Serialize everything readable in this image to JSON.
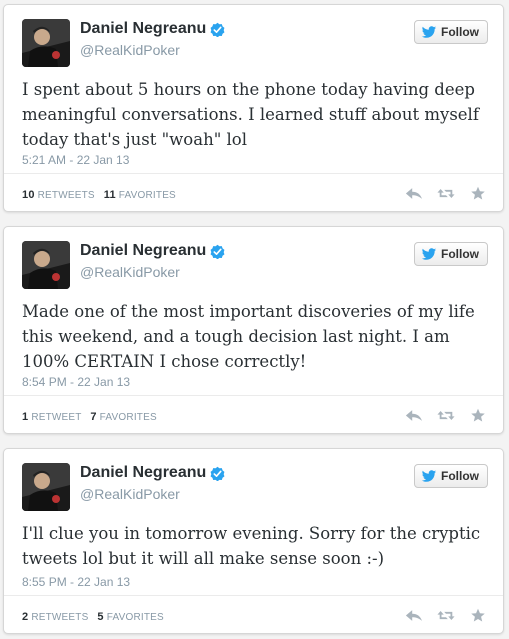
{
  "tweets": [
    {
      "name": "Daniel Negreanu",
      "handle": "@RealKidPoker",
      "follow_label": "Follow",
      "text": "I spent about 5 hours on the phone today having deep meaningful conversations. I learned stuff about myself today that's just \"woah\" lol",
      "time": "5:21 AM - 22 Jan 13",
      "retweets_count": "10",
      "retweets_label": "RETWEETS",
      "favorites_count": "11",
      "favorites_label": "FAVORITES"
    },
    {
      "name": "Daniel Negreanu",
      "handle": "@RealKidPoker",
      "follow_label": "Follow",
      "text": "Made one of the most important discoveries of my life this weekend, and a tough decision last night. I am 100% CERTAIN I chose correctly!",
      "time": "8:54 PM - 22 Jan 13",
      "retweets_count": "1",
      "retweets_label": "RETWEET",
      "favorites_count": "7",
      "favorites_label": "FAVORITES"
    },
    {
      "name": "Daniel Negreanu",
      "handle": "@RealKidPoker",
      "follow_label": "Follow",
      "text": "I'll clue you in tomorrow evening. Sorry for the cryptic tweets lol but it will all make sense soon :-)",
      "time": "8:55 PM - 22 Jan 13",
      "retweets_count": "2",
      "retweets_label": "RETWEETS",
      "favorites_count": "5",
      "favorites_label": "FAVORITES"
    }
  ],
  "icons": {
    "verified": "verified-badge-icon",
    "bird": "twitter-bird-icon",
    "reply": "reply-icon",
    "retweet": "retweet-icon",
    "favorite": "star-icon"
  },
  "colors": {
    "verified": "#2aa3ef",
    "bird": "#2aa3ef",
    "action_icons": "#aab4bc",
    "muted_text": "#8899a6"
  }
}
